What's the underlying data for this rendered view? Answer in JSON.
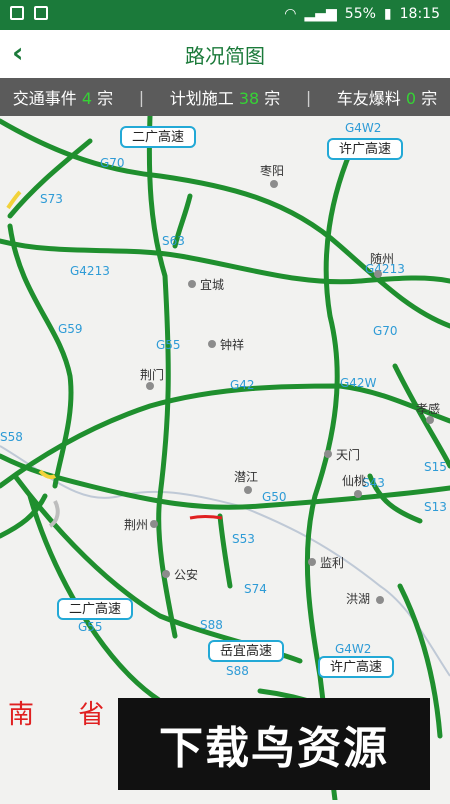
{
  "status": {
    "battery": "55%",
    "time": "18:15"
  },
  "header": {
    "back_icon": "chevron-left-icon",
    "title": "路况简图"
  },
  "summary": [
    {
      "label": "交通事件",
      "count": "4",
      "unit": "宗"
    },
    {
      "label": "计划施工",
      "count": "38",
      "unit": "宗"
    },
    {
      "label": "车友爆料",
      "count": "0",
      "unit": "宗"
    }
  ],
  "map": {
    "badges": [
      "二广高速",
      "许广高速",
      "二广高速",
      "岳宜高速",
      "许广高速"
    ],
    "codes": [
      "G70",
      "G4W2",
      "S73",
      "S63",
      "G4213",
      "G4213",
      "G59",
      "G55",
      "G42",
      "G42W",
      "G70",
      "S58",
      "S43",
      "S15",
      "G50",
      "S53",
      "S13",
      "S74",
      "G55",
      "S88",
      "S88",
      "G4W2"
    ],
    "cities": [
      "枣阳",
      "随州",
      "宜城",
      "钟祥",
      "荆门",
      "孝感",
      "天门",
      "潜江",
      "仙桃",
      "荆州",
      "公安",
      "监利",
      "洪湖"
    ],
    "province_text": "南  省",
    "watermark": "下载鸟资源"
  },
  "colors": {
    "header_green": "#1b7a3a",
    "road_green": "#1f8f2e",
    "count_green": "#36d236",
    "badge_blue": "#23a9d6",
    "incident_red": "#e02020"
  }
}
